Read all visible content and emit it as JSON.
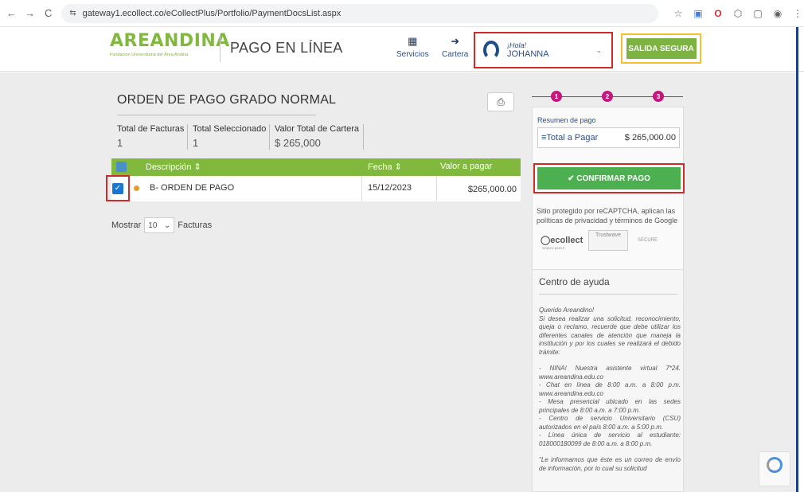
{
  "browser": {
    "url": "gateway1.ecollect.co/eCollectPlus/Portfolio/PaymentDocsList.aspx",
    "back_icon": "←",
    "forward_icon": "→",
    "reload_icon": "C",
    "site_info_icon": "⇆",
    "star_icon": "☆",
    "ext1_icon": "▣",
    "ext2_icon": "O",
    "ext3_icon": "⬡",
    "sidebar_icon": "▢",
    "profile_icon": "◉",
    "menu_icon": "⋮"
  },
  "header": {
    "logo_text": "AREANDINA",
    "logo_sub": "Fundación Universitaria del Área Andina",
    "page_heading": "PAGO EN LÍNEA",
    "nav_servicios": "Servicios",
    "nav_servicios_icon": "▦",
    "nav_cartera": "Cartera",
    "nav_cartera_icon": "➜",
    "user_greeting": "¡Hola!",
    "user_name": "JOHANNA",
    "user_chevron": "⌄",
    "logout_label": "SALIDA SEGURA"
  },
  "order": {
    "title": "ORDEN DE PAGO GRADO NORMAL",
    "print_icon": "⎙",
    "summary": [
      {
        "label": "Total de Facturas",
        "value": "1"
      },
      {
        "label": "Total Seleccionado",
        "value": "1"
      },
      {
        "label": "Valor Total de Cartera",
        "value": "$ 265,000"
      }
    ],
    "table": {
      "headers": {
        "description": "Descripción ⇕",
        "date": "Fecha ⇕",
        "amount": "Valor a pagar"
      },
      "rows": [
        {
          "checked": "✓",
          "description": "B- ORDEN DE PAGO",
          "date": "15/12/2023",
          "amount": "$265,000.00"
        }
      ]
    },
    "pager": {
      "prefix": "Mostrar",
      "page_size": "10",
      "chevron": "⌄",
      "suffix": "Facturas"
    }
  },
  "steps": [
    "1",
    "2",
    "3"
  ],
  "payment": {
    "summary_label": "Resumen de pago",
    "total_label": "≡Total a Pagar",
    "total_value": "$ 265,000.00",
    "confirm_label": "✔ CONFIRMAR PAGO",
    "captcha_text": "Sitio protegido por reCAPTCHA, aplican las políticas de privacidad y términos de Google",
    "ecollect": "◯ecollect",
    "ecollect_sub": "Seguro para ti",
    "trustwave": "Trustwave",
    "secure": "SECURE"
  },
  "help": {
    "title": "Centro de ayuda",
    "paragraphs": [
      "Querido Areandino!",
      "Si desea realizar una solicitud, reconocimiento, queja o reclamo, recuerde que debe utilizar los diferentes canales de atención que maneja la institución y por los cuales se realizará el debido trámite:",
      "",
      "- NINA! Nuestra asistente virtual 7*24. www.areandina.edu.co",
      "- Chat en línea de 8:00 a.m. a 8:00 p.m. www.areandina.edu.co",
      "- Mesa presencial ubicado en las sedes principales de 8:00 a.m. a 7:00 p.m.",
      "- Centro de servicio Universitario (CSU) autorizados en el país 8:00 a.m. a 5:00 p.m.",
      "- Línea única de servicio al estudiante: 018000180099 de 8:00 a.m. a 8:00 p.m.",
      "",
      "\"Le informamos que éste es un correo de envío de información, por lo cual su solicitud"
    ]
  },
  "colors": {
    "brand_green": "#80b93d",
    "navy": "#1b3f8b",
    "step_magenta": "#c4187f",
    "highlight_red": "#d12a2a",
    "highlight_yellow": "#f2c12e"
  }
}
